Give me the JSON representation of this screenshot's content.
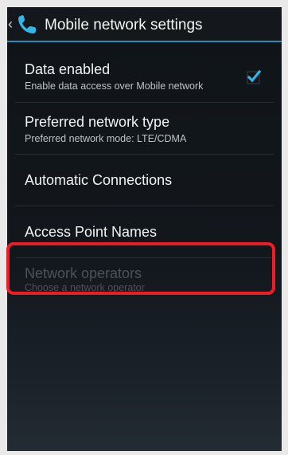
{
  "action_bar": {
    "title": "Mobile network settings",
    "up_icon": "chevron-left-icon",
    "app_icon": "phone-icon",
    "accent_color": "#1f8fb8"
  },
  "preferences": [
    {
      "label": "Data enabled",
      "summary": "Enable data access over Mobile network",
      "checked": true,
      "enabled": true
    },
    {
      "label": "Preferred network type",
      "summary": "Preferred network mode: LTE/CDMA",
      "enabled": true
    },
    {
      "label": "Automatic Connections",
      "enabled": true
    },
    {
      "label": "Access Point Names",
      "enabled": true
    },
    {
      "label": "Network operators",
      "summary": "Choose a network operator",
      "enabled": false,
      "highlighted": true
    }
  ],
  "colors": {
    "checkbox": "#33b5e5",
    "highlight_border": "#ee1c24"
  }
}
